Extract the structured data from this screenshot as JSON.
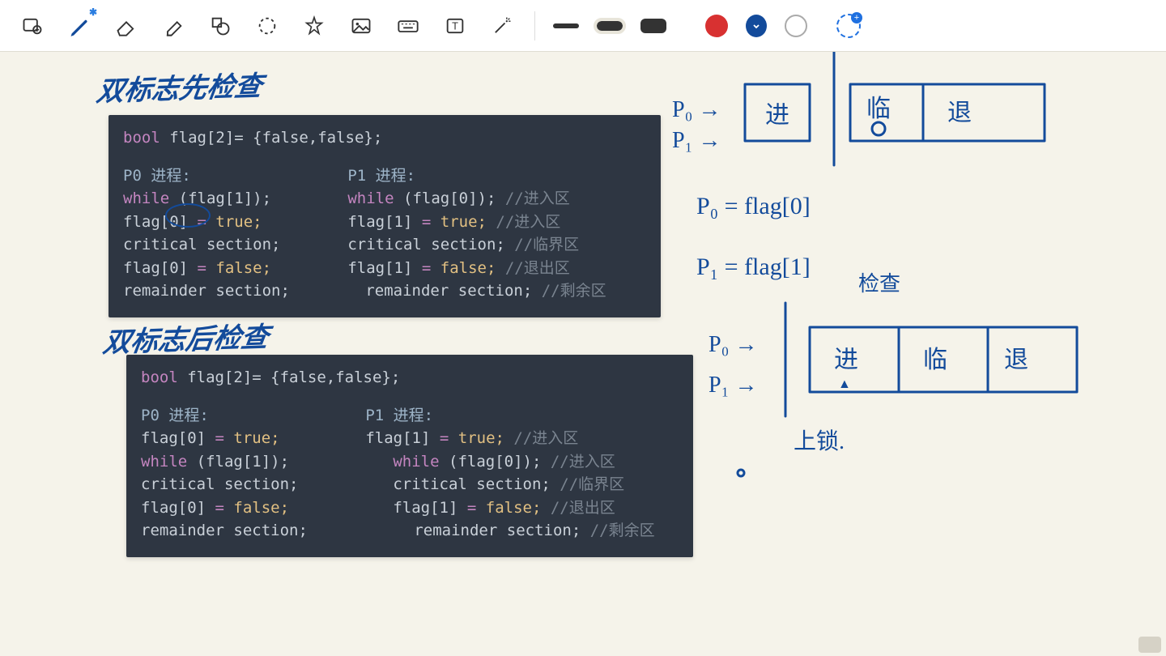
{
  "toolbar": {
    "tools": [
      "zoom-add",
      "pen",
      "eraser",
      "highlighter",
      "shapes",
      "lasso",
      "star-shape",
      "image",
      "keyboard",
      "text",
      "laser-pointer"
    ],
    "active_tool": "pen",
    "stroke_widths": [
      "thin",
      "mid",
      "thick"
    ],
    "active_width": "mid",
    "colors": [
      "#d83131",
      "#134b9b",
      "#ffffff"
    ],
    "active_color": "#134b9b"
  },
  "notes": {
    "title1": "双标志先检查",
    "title2": "双标志后检查",
    "code1": {
      "decl_type": "bool",
      "decl_rest": " flag[2]= {false,false};",
      "p0_label": "P0 进程:",
      "p1_label": "P1 进程:",
      "p0_lines": {
        "while": "while",
        "while_cond": " (flag[1]);",
        "set": "flag[0] ",
        "eq": "=",
        "true": " true;",
        "crit": "critical section;",
        "reset": "flag[0] ",
        "false": " false;",
        "rem": "remainder section;"
      },
      "p1_lines": {
        "while": "while",
        "while_cond": " (flag[0]);",
        "cmt_in": "  //进入区",
        "set": "flag[1] ",
        "eq": "=",
        "true": " true;",
        "cmt_in2": "  //进入区",
        "crit": "critical section;",
        "cmt_crit": " //临界区",
        "reset": "flag[1] ",
        "false": " false;",
        "cmt_out": " //退出区",
        "rem": "remainder section;",
        "cmt_rem": "  //剩余区"
      }
    },
    "code2": {
      "decl_type": "bool",
      "decl_rest": " flag[2]= {false,false};",
      "p0_label": "P0 进程:",
      "p1_label": "P1 进程:",
      "p0_lines": {
        "set": "flag[0] ",
        "eq": "=",
        "true": " true;",
        "while": "while",
        "while_cond": " (flag[1]);",
        "crit": "critical section;",
        "reset": "flag[0] ",
        "false": " false;",
        "rem": "remainder section;"
      },
      "p1_lines": {
        "set": "flag[1] ",
        "eq": "=",
        "true": " true;",
        "cmt_in": "  //进入区",
        "while": "while",
        "while_cond": " (flag[0]);",
        "cmt_in2": "  //进入区",
        "crit": "critical section;",
        "cmt_crit": " //临界区",
        "reset": "flag[1] ",
        "false": " false;",
        "cmt_out": " //退出区",
        "rem": "remainder section;",
        "cmt_rem": "  //剩余区"
      }
    },
    "hand": {
      "p0_arrow": "P₀ →",
      "p1_arrow": "P₁ →",
      "jin": "进",
      "lin": "临",
      "tui": "退",
      "p0_flag": "P₀ = flag[0]",
      "p1_flag": "P₁ = flag[1]",
      "houcha": "检查",
      "p0_arrow2": "P₀ →",
      "p1_arrow2": "P₁ →",
      "shangsuo": "上锁."
    }
  }
}
